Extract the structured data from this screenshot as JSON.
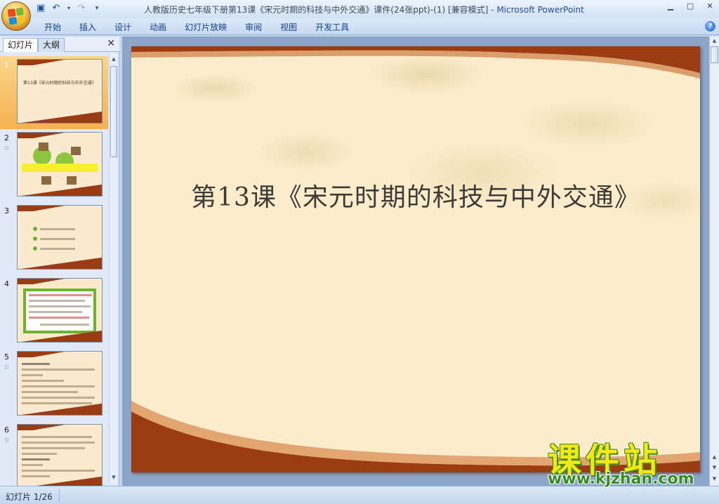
{
  "window": {
    "title_doc": "人教版历史七年级下册第13课《宋元时期的科技与中外交通》课件(24张ppt)-(1) [兼容模式]",
    "title_sep": " - ",
    "title_app": "Microsoft PowerPoint"
  },
  "ribbon": {
    "tabs": [
      "开始",
      "插入",
      "设计",
      "动画",
      "幻灯片放映",
      "审阅",
      "视图",
      "开发工具"
    ],
    "help": "?"
  },
  "pane": {
    "tab_slides": "幻灯片",
    "tab_outline": "大纲",
    "close": "✕",
    "thumbnails": [
      {
        "num": "1",
        "caption": "第13课《宋元时期的科技与中外交通》"
      },
      {
        "num": "2"
      },
      {
        "num": "3"
      },
      {
        "num": "4"
      },
      {
        "num": "5"
      },
      {
        "num": "6"
      }
    ]
  },
  "slide": {
    "title": "第13课《宋元时期的科技与中外交通》"
  },
  "status": {
    "slide_info": "幻灯片 1/26"
  },
  "watermark": {
    "logo": "课件站",
    "url": "www.kjzhan.com"
  },
  "colors": {
    "accent_orange": "#f5b152",
    "slide_brown": "#9b3d14",
    "slide_cream": "#fbeccb"
  }
}
